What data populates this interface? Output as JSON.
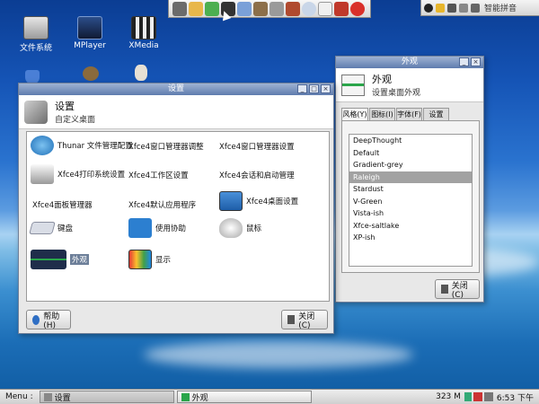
{
  "desktop": {
    "icons": [
      {
        "label": "文件系统",
        "icon": "filesystem-icon"
      },
      {
        "label": "MPlayer",
        "icon": "mplayer-icon"
      },
      {
        "label": "XMedia",
        "icon": "xmedia-icon"
      }
    ]
  },
  "launcher": {
    "icons": [
      "user-icon",
      "folder-icon",
      "home-icon",
      "terminal-icon",
      "edit-icon",
      "package-icon",
      "tools-icon",
      "briefcase-icon",
      "search-icon",
      "mail-icon",
      "gear-icon",
      "power-icon"
    ]
  },
  "tray_top": {
    "label": "智能拼音"
  },
  "settings_window": {
    "title": "设置",
    "header_title": "设置",
    "header_subtitle": "自定义桌面",
    "items": [
      {
        "label": "Thunar 文件管理配置",
        "icon": "thunar-icon"
      },
      {
        "label": "Xfce4窗口管理器调整",
        "icon": ""
      },
      {
        "label": "Xfce4窗口管理器设置",
        "icon": ""
      },
      {
        "label": "Xfce4打印系统设置",
        "icon": "printer-icon"
      },
      {
        "label": "Xfce4工作区设置",
        "icon": ""
      },
      {
        "label": "Xfce4会话和启动管理",
        "icon": ""
      },
      {
        "label": "Xfce4面板管理器",
        "icon": ""
      },
      {
        "label": "Xfce4默认应用程序",
        "icon": ""
      },
      {
        "label": "Xfce4桌面设置",
        "icon": "desktop-settings-icon"
      },
      {
        "label": "键盘",
        "icon": "keyboard-icon"
      },
      {
        "label": "使用协助",
        "icon": "accessibility-icon"
      },
      {
        "label": "鼠标",
        "icon": "mouse-icon"
      },
      {
        "label": "外观",
        "icon": "appearance-icon"
      },
      {
        "label": "显示",
        "icon": "display-icon"
      }
    ],
    "help_button": "帮助(H)",
    "close_button": "关闭(C)"
  },
  "appearance_window": {
    "title": "外观",
    "header_title": "外观",
    "header_subtitle": "设置桌面外观",
    "tabs": [
      "风格(Y)",
      "图标(I)",
      "字体(F)",
      "设置(S)"
    ],
    "active_tab": "风格(Y)",
    "themes": [
      "DeepThought",
      "Default",
      "Gradient-grey",
      "Raleigh",
      "Stardust",
      "V-Green",
      "Vista-ish",
      "Xfce-saltlake",
      "XP-ish"
    ],
    "selected_theme": "Raleigh",
    "close_button": "关闭(C)"
  },
  "taskbar": {
    "menu_label": "Menu :",
    "tasks": [
      {
        "label": "设置",
        "active": true
      },
      {
        "label": "外观",
        "active": false
      }
    ],
    "memory": "323 M",
    "time": "6:53 下午"
  }
}
